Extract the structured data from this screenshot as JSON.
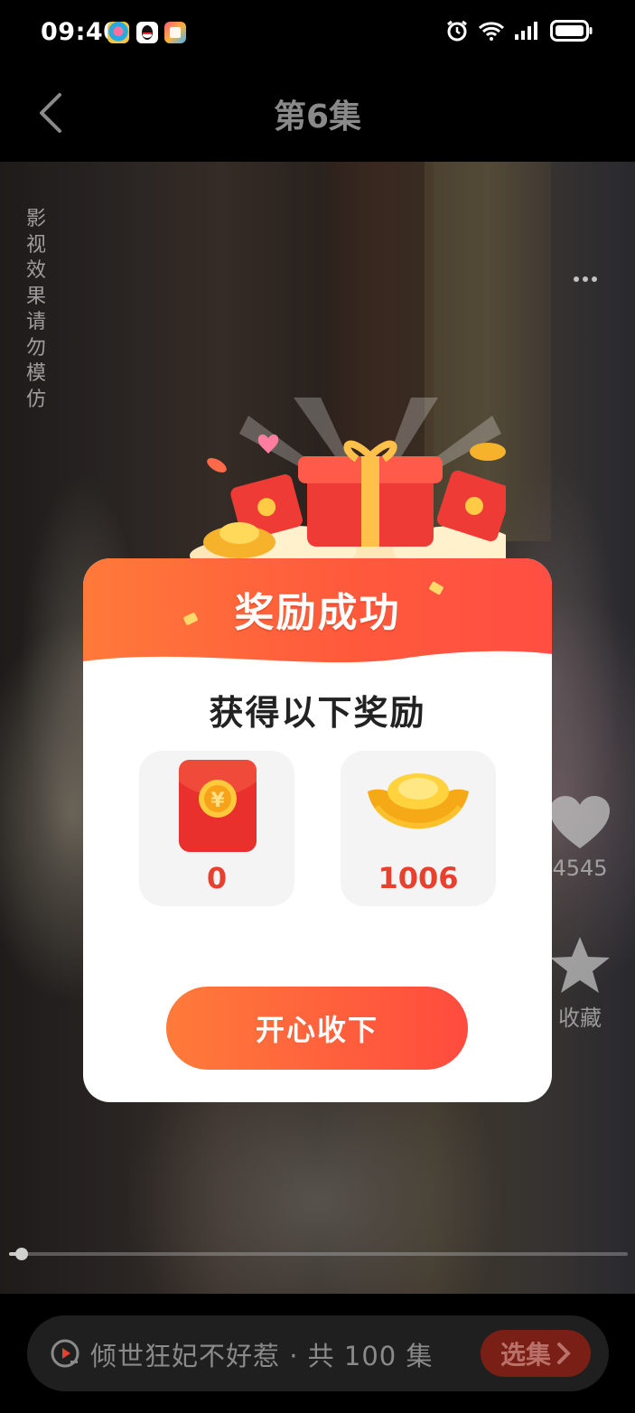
{
  "status_bar": {
    "time": "09:40",
    "app_icons": [
      "game-app-icon",
      "qq-icon",
      "store-app-icon"
    ],
    "indicators": [
      "alarm-icon",
      "wifi-icon",
      "signal-icon",
      "battery-icon"
    ]
  },
  "header": {
    "back_icon": "chevron-left-icon",
    "title": "第6集"
  },
  "video": {
    "disclaimer": "影视效果请勿模仿",
    "more_icon": "more-dots-icon",
    "like_count": "4545",
    "collect_label": "收藏",
    "progress": 0.02
  },
  "bottom_bar": {
    "series_icon": "play-history-icon",
    "series_title": "倾世狂妃不好惹 · 共 100 集",
    "select_episodes_label": "选集"
  },
  "reward_dialog": {
    "title": "奖励成功",
    "subtitle": "获得以下奖励",
    "rewards": [
      {
        "icon": "red-envelope-icon",
        "value": "0"
      },
      {
        "icon": "gold-ingot-icon",
        "value": "1006"
      }
    ],
    "accept_label": "开心收下"
  },
  "colors": {
    "accent": "#ff5a3c",
    "reward_value": "#e8402e",
    "dialog_bg": "#ffffff"
  }
}
